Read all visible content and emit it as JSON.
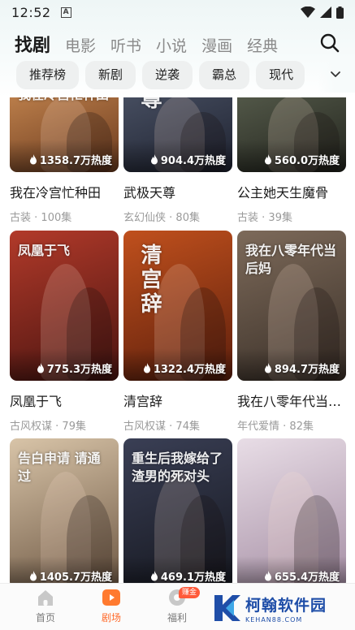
{
  "status_bar": {
    "time": "12:52",
    "notification_icon": "A"
  },
  "category_tabs": [
    {
      "label": "找剧",
      "active": true
    },
    {
      "label": "电影",
      "active": false
    },
    {
      "label": "听书",
      "active": false
    },
    {
      "label": "小说",
      "active": false
    },
    {
      "label": "漫画",
      "active": false
    },
    {
      "label": "经典",
      "active": false
    }
  ],
  "filter_chips": [
    {
      "label": "推荐榜"
    },
    {
      "label": "新剧"
    },
    {
      "label": "逆袭"
    },
    {
      "label": "霸总"
    },
    {
      "label": "现代"
    }
  ],
  "dramas": [
    {
      "title": "我在冷宫忙种田",
      "heat": "1358.7万热度",
      "genre": "古装",
      "episodes": "100集",
      "poster_text": "我在冷宫忙种田",
      "colors": [
        "#c98a52",
        "#6b3a1e"
      ]
    },
    {
      "title": "武极天尊",
      "heat": "904.4万热度",
      "genre": "玄幻仙侠",
      "episodes": "80集",
      "poster_text": "尊",
      "colors": [
        "#4d5568",
        "#1e2230"
      ]
    },
    {
      "title": "公主她天生魔骨",
      "heat": "560.0万热度",
      "genre": "古装",
      "episodes": "39集",
      "poster_text": "",
      "colors": [
        "#5b6150",
        "#22241d"
      ]
    },
    {
      "title": "凤凰于飞",
      "heat": "775.3万热度",
      "genre": "古风权谋",
      "episodes": "79集",
      "poster_text": "凤凰于飞",
      "colors": [
        "#b23a2a",
        "#4a1410"
      ]
    },
    {
      "title": "清宫辞",
      "heat": "1322.4万热度",
      "genre": "古风权谋",
      "episodes": "74集",
      "poster_text": "清宫辞",
      "colors": [
        "#c0501d",
        "#5e1f0c"
      ]
    },
    {
      "title": "我在八零年代当后妈",
      "heat": "894.7万热度",
      "genre": "年代爱情",
      "episodes": "82集",
      "poster_text": "我在八零年代当后妈",
      "colors": [
        "#7d6a5a",
        "#3a3028"
      ]
    },
    {
      "title": "",
      "heat": "1405.7万热度",
      "genre": "",
      "episodes": "",
      "poster_text": "告白申请 请通过",
      "colors": [
        "#d8c4a8",
        "#6e5844"
      ]
    },
    {
      "title": "",
      "heat": "469.1万热度",
      "genre": "",
      "episodes": "",
      "poster_text": "重生后我嫁给了 渣男的死对头",
      "colors": [
        "#3a3f55",
        "#15171f"
      ]
    },
    {
      "title": "",
      "heat": "655.4万热度",
      "genre": "",
      "episodes": "",
      "poster_text": "",
      "colors": [
        "#e8dde6",
        "#a58ea4"
      ]
    }
  ],
  "bottom_nav": [
    {
      "label": "首页",
      "icon": "home-icon",
      "active": false
    },
    {
      "label": "剧场",
      "icon": "theater-play-icon",
      "active": true
    },
    {
      "label": "福利",
      "icon": "welfare-coin-icon",
      "active": false,
      "badge": "赚金"
    }
  ],
  "watermark": {
    "main": "柯翰软件园",
    "sub": "KEHAN88.COM"
  },
  "accent_colors": {
    "active_nav": "#ff6a2a",
    "tab_underline": "#9ee3d8"
  }
}
